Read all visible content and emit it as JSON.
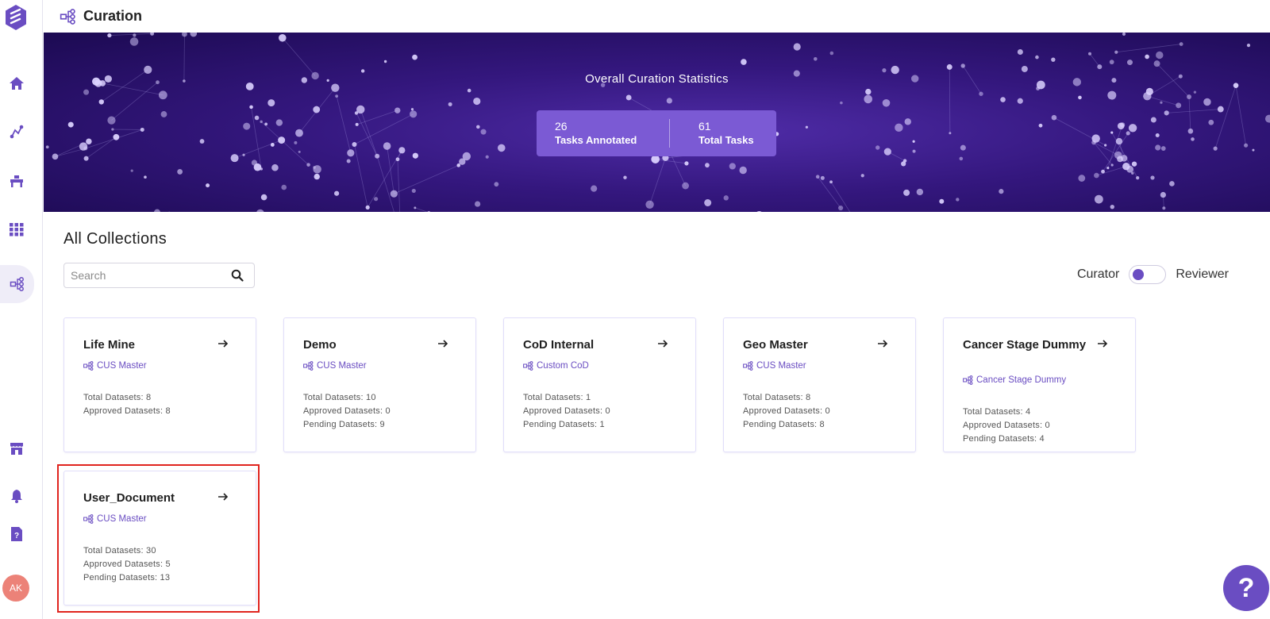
{
  "header": {
    "title": "Curation"
  },
  "banner": {
    "title": "Overall Curation Statistics",
    "stats": [
      {
        "value": "26",
        "label": "Tasks Annotated"
      },
      {
        "value": "61",
        "label": "Total Tasks"
      }
    ]
  },
  "collections": {
    "title": "All Collections",
    "search_placeholder": "Search",
    "toggle": {
      "left_label": "Curator",
      "right_label": "Reviewer",
      "selected": "Curator"
    },
    "cards": [
      {
        "title": "Life Mine",
        "tag": "CUS Master",
        "stats": [
          "Total Datasets: 8",
          "Approved Datasets: 8"
        ]
      },
      {
        "title": "Demo",
        "tag": "CUS Master",
        "stats": [
          "Total Datasets: 10",
          "Approved Datasets: 0",
          "Pending Datasets: 9"
        ]
      },
      {
        "title": "CoD Internal",
        "tag": "Custom CoD",
        "stats": [
          "Total Datasets: 1",
          "Approved Datasets: 0",
          "Pending Datasets: 1"
        ]
      },
      {
        "title": "Geo Master",
        "tag": "CUS Master",
        "stats": [
          "Total Datasets: 8",
          "Approved Datasets: 0",
          "Pending Datasets: 8"
        ]
      },
      {
        "title": "Cancer Stage Dummy",
        "tag": "Cancer Stage Dummy",
        "stats": [
          "Total Datasets: 4",
          "Approved Datasets: 0",
          "Pending Datasets: 4"
        ]
      },
      {
        "title": "User_Document",
        "tag": "CUS Master",
        "stats": [
          "Total Datasets: 30",
          "Approved Datasets: 5",
          "Pending Datasets: 13"
        ]
      }
    ]
  },
  "sidebar": {
    "items": [
      {
        "icon": "home-icon"
      },
      {
        "icon": "workflow-icon"
      },
      {
        "icon": "workbench-icon"
      },
      {
        "icon": "apps-grid-icon"
      },
      {
        "icon": "curation-icon",
        "active": true
      },
      {
        "icon": "store-icon"
      },
      {
        "icon": "bell-icon"
      },
      {
        "icon": "help-doc-icon"
      }
    ],
    "avatar_initials": "AK"
  },
  "help_button": "?",
  "colors": {
    "accent": "#6a4dc2",
    "banner_dark": "#1c0a52",
    "stat_box": "#7b5ad4",
    "highlight": "#e0241e"
  }
}
